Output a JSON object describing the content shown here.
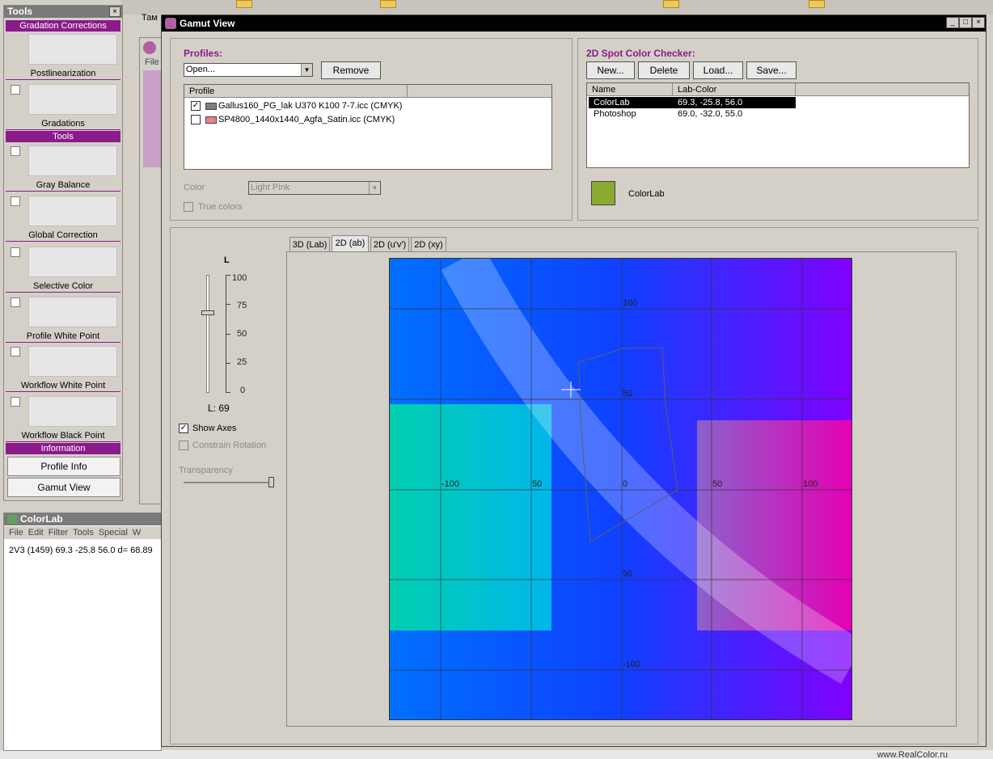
{
  "desktop": {
    "footer_url": "www.RealColor.ru",
    "behind_label": "Там"
  },
  "tools_panel": {
    "title": "Tools",
    "close": "×",
    "sections": {
      "gradation": "Gradation Corrections",
      "tools": "Tools",
      "information": "Information"
    },
    "items": [
      {
        "label": "Postlinearization"
      },
      {
        "label": "Gradations"
      },
      {
        "label": "Gray Balance"
      },
      {
        "label": "Global Correction"
      },
      {
        "label": "Selective Color"
      },
      {
        "label": "Profile White Point"
      },
      {
        "label": "Workflow White Point"
      },
      {
        "label": "Workflow Black Point"
      }
    ],
    "buttons": {
      "profile_info": "Profile Info",
      "gamut_view": "Gamut View"
    }
  },
  "colorlab_window": {
    "title": "ColorLab",
    "menu": [
      "File",
      "Edit",
      "Filter",
      "Tools",
      "Special",
      "W"
    ],
    "line": "2V3  (1459)  69.3 -25.8  56.0 d= 68.89"
  },
  "bg_window": {
    "menu_label": "File"
  },
  "gamut_window": {
    "title": "Gamut View",
    "profiles": {
      "heading": "Profiles:",
      "open_value": "Open...",
      "remove_label": "Remove",
      "column": "Profile",
      "rows": [
        {
          "checked": "✓",
          "name": "Gallus160_PG_lak U370 K100 7-7.icc (CMYK)",
          "swatch": "#808080"
        },
        {
          "checked": "",
          "name": "SP4800_1440x1440_Agfa_Satin.icc (CMYK)",
          "swatch": "#f08080"
        }
      ],
      "color_label": "Color",
      "color_value": "Light Pink",
      "true_colors": "True colors"
    },
    "spot_checker": {
      "heading": "2D Spot Color Checker:",
      "buttons": [
        "New...",
        "Delete",
        "Load...",
        "Save..."
      ],
      "columns": [
        "Name",
        "Lab-Color"
      ],
      "rows": [
        {
          "name": "ColorLab",
          "lab": "69.3, -25.8, 56.0",
          "selected": true
        },
        {
          "name": "Photoshop",
          "lab": "69.0, -32.0, 55.0",
          "selected": false
        }
      ],
      "swatch_color": "#8aaa30",
      "swatch_label": "ColorLab"
    },
    "tabs": [
      "3D (Lab)",
      "2D (ab)",
      "2D (u'v')",
      "2D (xy)"
    ],
    "active_tab": 1,
    "l_slider": {
      "heading": "L",
      "ticks": [
        "100",
        "75",
        "50",
        "25",
        "0"
      ],
      "value": 69,
      "readout": "L: 69"
    },
    "show_axes": "Show Axes",
    "constrain_rotation": "Constrain Rotation",
    "transparency_label": "Transparency",
    "transparency_value": 1.0,
    "plot": {
      "axis_labels": [
        "100",
        "50",
        "-100",
        "50",
        "0",
        "50",
        "100",
        "50",
        "-100"
      ]
    }
  }
}
